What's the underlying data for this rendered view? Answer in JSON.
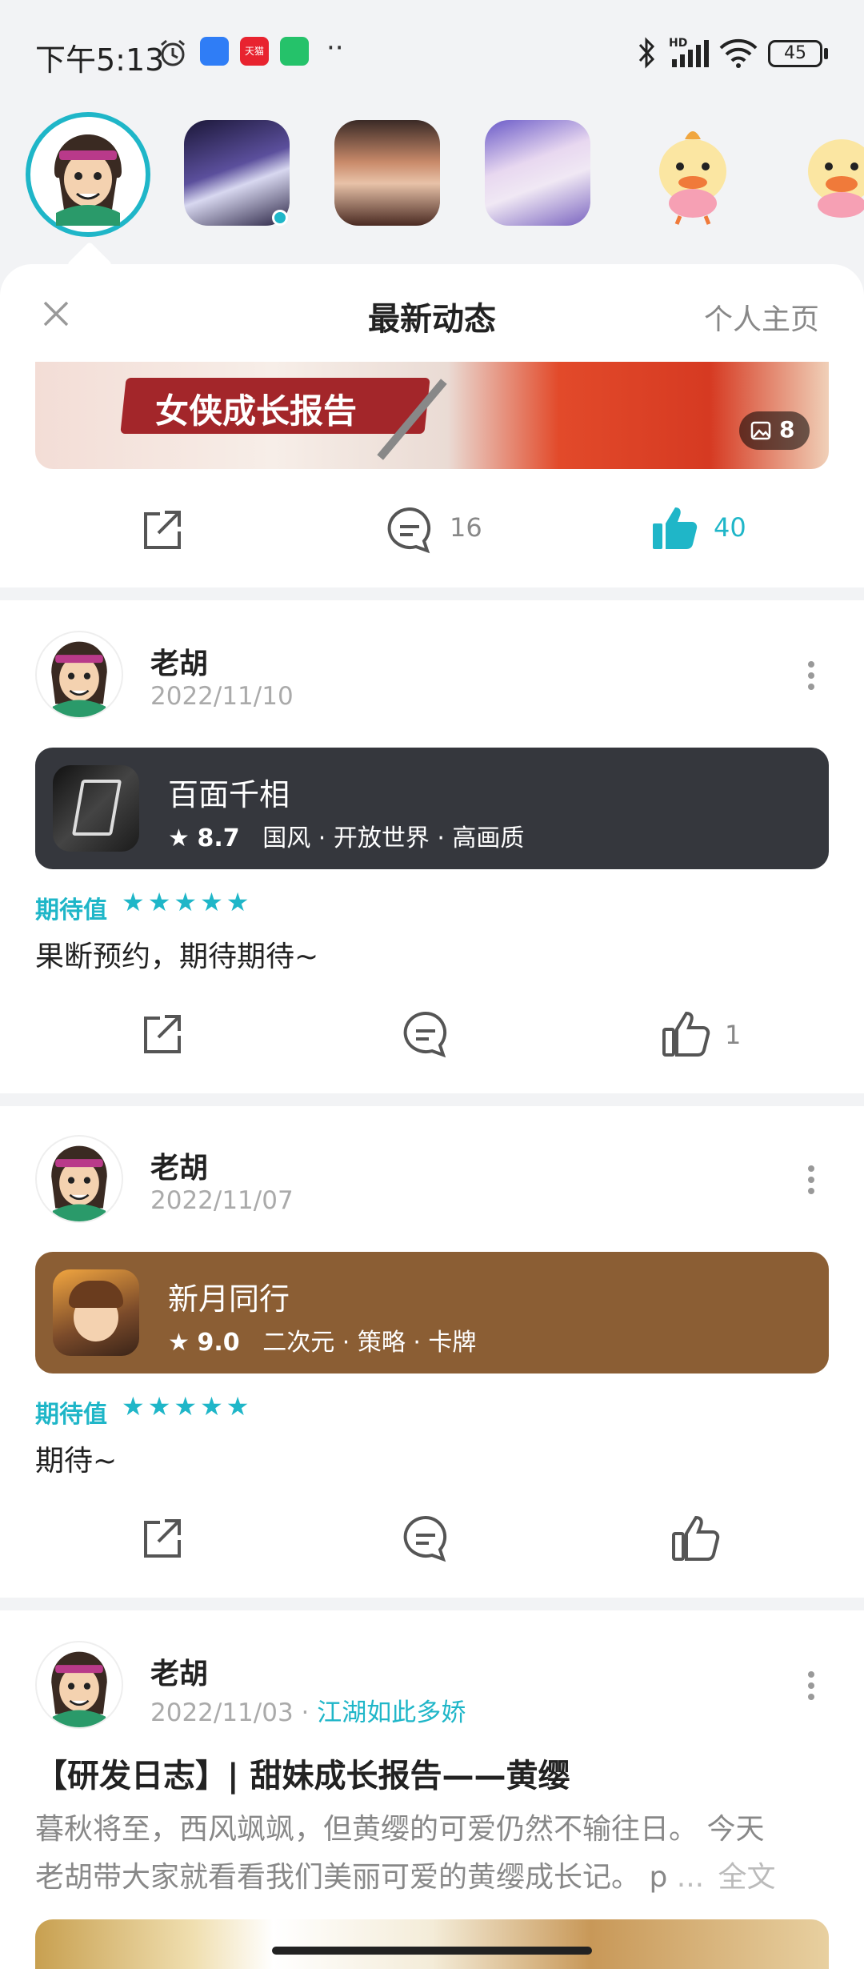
{
  "status_bar": {
    "time": "下午5:13",
    "app_badge": "天猫",
    "dots": "··",
    "battery": "45",
    "hd": "HD"
  },
  "panel": {
    "title": "最新动态",
    "profile_link": "个人主页"
  },
  "top_post": {
    "banner_text": "女侠成长报告",
    "image_count": "8",
    "comments": "16",
    "likes": "40"
  },
  "posts": [
    {
      "author": "老胡",
      "date": "2022/11/10",
      "game": {
        "title": "百面千相",
        "rating": "8.7",
        "tags": "国风 · 开放世界 · 高画质",
        "card_color": "#35373d"
      },
      "expect_label": "期待值",
      "stars": "★★★★★",
      "text": "果断预约，期待期待~",
      "likes": "1"
    },
    {
      "author": "老胡",
      "date": "2022/11/07",
      "game": {
        "title": "新月同行",
        "rating": "9.0",
        "tags": "二次元 · 策略 · 卡牌",
        "card_color": "#8b5e34"
      },
      "expect_label": "期待值",
      "stars": "★★★★★",
      "text": "期待~"
    },
    {
      "author": "老胡",
      "date": "2022/11/03",
      "date_sep": "·",
      "forum": "江湖如此多娇",
      "title": "【研发日志】| 甜妹成长报告——黄缨",
      "body_line1": "暮秋将至，西风飒飒，但黄缨的可爱仍然不输往日。 今天",
      "body_line2": "老胡带大家就看看我们美丽可爱的黄缨成长记。 p",
      "ellipsis": "...",
      "full_text": "全文"
    }
  ],
  "colors": {
    "accent": "#1fb6c8",
    "bg": "#f2f3f5"
  }
}
